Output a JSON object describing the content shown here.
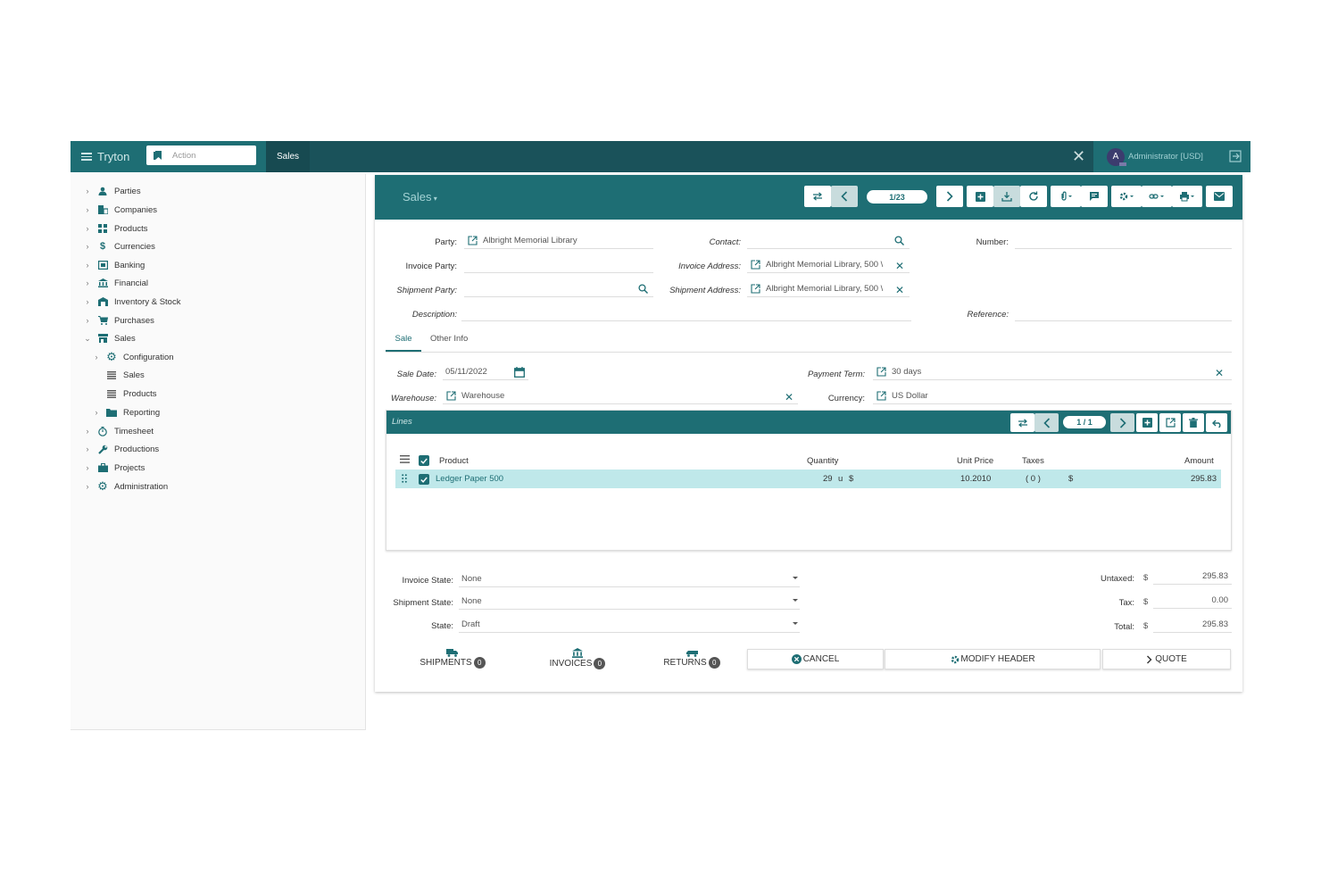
{
  "topbar": {
    "brand": "Tryton",
    "action_placeholder": "Action",
    "active_tab": "Sales",
    "user": "Administrator [USD]",
    "avatar_initial": "A"
  },
  "sidebar": {
    "items": [
      {
        "label": "Parties",
        "icon": "person-icon"
      },
      {
        "label": "Companies",
        "icon": "building-icon"
      },
      {
        "label": "Products",
        "icon": "grid-icon"
      },
      {
        "label": "Currencies",
        "icon": "dollar-icon"
      },
      {
        "label": "Banking",
        "icon": "bank-card-icon"
      },
      {
        "label": "Financial",
        "icon": "bank-icon"
      },
      {
        "label": "Inventory & Stock",
        "icon": "warehouse-icon"
      },
      {
        "label": "Purchases",
        "icon": "cart-icon"
      },
      {
        "label": "Sales",
        "icon": "store-icon"
      },
      {
        "label": "Configuration",
        "icon": "gear-icon"
      },
      {
        "label": "Sales",
        "icon": "list-icon"
      },
      {
        "label": "Products",
        "icon": "list-icon"
      },
      {
        "label": "Reporting",
        "icon": "folder-icon"
      },
      {
        "label": "Timesheet",
        "icon": "stopwatch-icon"
      },
      {
        "label": "Productions",
        "icon": "wrench-icon"
      },
      {
        "label": "Projects",
        "icon": "briefcase-icon"
      },
      {
        "label": "Administration",
        "icon": "gear-icon"
      }
    ]
  },
  "panel": {
    "title": "Sales",
    "record_pager": "1/23"
  },
  "form": {
    "party_label": "Party:",
    "party_value": "Albright Memorial Library",
    "contact_label": "Contact:",
    "number_label": "Number:",
    "invoice_party_label": "Invoice Party:",
    "invoice_address_label": "Invoice Address:",
    "invoice_address_value": "Albright Memorial Library, 500 \\",
    "shipment_party_label": "Shipment Party:",
    "shipment_address_label": "Shipment Address:",
    "shipment_address_value": "Albright Memorial Library, 500 \\",
    "description_label": "Description:",
    "reference_label": "Reference:",
    "tab_sale": "Sale",
    "tab_other": "Other Info",
    "sale_date_label": "Sale Date:",
    "sale_date_value": "05/11/2022",
    "payment_term_label": "Payment Term:",
    "payment_term_value": "30 days",
    "warehouse_label": "Warehouse:",
    "warehouse_value": "Warehouse",
    "currency_label": "Currency:",
    "currency_value": "US Dollar"
  },
  "lines": {
    "title": "Lines",
    "pager": "1 / 1",
    "columns": [
      "Product",
      "Quantity",
      "Unit Price",
      "Taxes",
      "Amount"
    ],
    "rows": [
      {
        "product": "Ledger Paper 500",
        "quantity": "29",
        "unit": "u",
        "qty_currency": "$",
        "unit_price": "10.2010",
        "taxes": "( 0 )",
        "tax_currency": "$",
        "amount": "295.83"
      }
    ]
  },
  "footer": {
    "invoice_state_label": "Invoice State:",
    "invoice_state_value": "None",
    "shipment_state_label": "Shipment State:",
    "shipment_state_value": "None",
    "state_label": "State:",
    "state_value": "Draft",
    "untaxed_label": "Untaxed:",
    "untaxed_value": "295.83",
    "tax_label": "Tax:",
    "tax_value": "0.00",
    "total_label": "Total:",
    "total_value": "295.83",
    "currency_symbol": "$",
    "shipments_label": "SHIPMENTS",
    "shipments_count": "0",
    "invoices_label": "INVOICES",
    "invoices_count": "0",
    "returns_label": "RETURNS",
    "returns_count": "0",
    "cancel_label": "CANCEL",
    "modify_header_label": "MODIFY HEADER",
    "quote_label": "QUOTE"
  },
  "colors": {
    "topbar": "#1a525a",
    "accent": "#1e6e74",
    "row_highlight": "#bfe8ea"
  }
}
